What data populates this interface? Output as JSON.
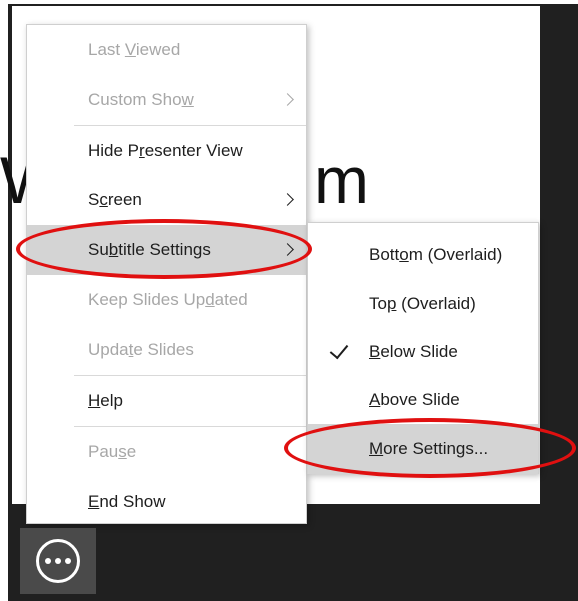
{
  "slide": {
    "title_left": "W",
    "title_right": "m"
  },
  "main_menu": {
    "items": [
      {
        "label_pre": "Last ",
        "label_u": "V",
        "label_post": "iewed"
      },
      {
        "label_pre": "Custom Sho",
        "label_u": "w",
        "label_post": ""
      },
      {
        "label_pre": "Hide P",
        "label_u": "r",
        "label_post": "esenter View"
      },
      {
        "label_pre": "S",
        "label_u": "c",
        "label_post": "reen"
      },
      {
        "label_pre": "Su",
        "label_u": "b",
        "label_post": "title Settings"
      },
      {
        "label_pre": "Keep Slides Up",
        "label_u": "d",
        "label_post": "ated"
      },
      {
        "label_pre": "Upda",
        "label_u": "t",
        "label_post": "e Slides"
      },
      {
        "label_pre": "",
        "label_u": "H",
        "label_post": "elp"
      },
      {
        "label_pre": "Pau",
        "label_u": "s",
        "label_post": "e"
      },
      {
        "label_pre": "",
        "label_u": "E",
        "label_post": "nd Show"
      }
    ]
  },
  "sub_menu": {
    "items": [
      {
        "label_pre": "Bott",
        "label_u": "o",
        "label_post": "m (Overlaid)"
      },
      {
        "label_pre": "To",
        "label_u": "p",
        "label_post": " (Overlaid)"
      },
      {
        "label_pre": "",
        "label_u": "B",
        "label_post": "elow Slide"
      },
      {
        "label_pre": "",
        "label_u": "A",
        "label_post": "bove Slide"
      },
      {
        "label_pre": "",
        "label_u": "M",
        "label_post": "ore Settings..."
      }
    ]
  },
  "colors": {
    "annotation": "#e01010",
    "highlight": "#d4d4d4",
    "disabled_text": "#a7a7a7"
  },
  "icons": {
    "more_button": "ellipsis-icon",
    "submenu_arrow": "chevron-right-icon",
    "selected": "checkmark-icon"
  }
}
